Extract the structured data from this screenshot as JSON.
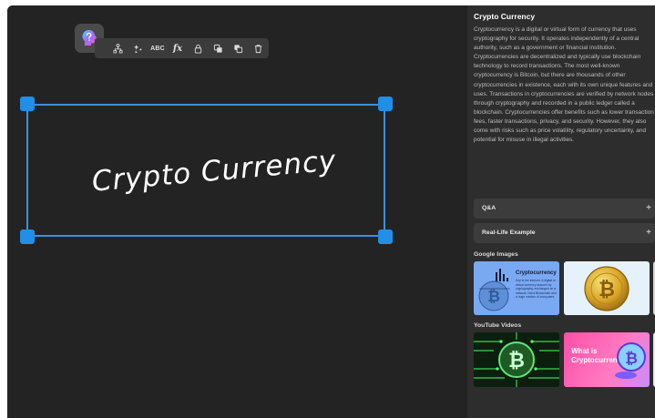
{
  "canvas": {
    "handwritten_text": "Crypto Currency",
    "toolbar": {
      "abc_label": "ABC",
      "fx_label": "fx"
    }
  },
  "panel": {
    "title": "Crypto Currency",
    "description": "Cryptocurrency is a digital or virtual form of currency that uses cryptography for security. It operates independently of a central authority, such as a government or financial institution. Cryptocurrencies are decentralized and typically use blockchain technology to record transactions. The most well-known cryptocurrency is Bitcoin, but there are thousands of other cryptocurrencies in existence, each with its own unique features and uses. Transactions in cryptocurrencies are verified by network nodes through cryptography and recorded in a public ledger called a blockchain. Cryptocurrencies offer benefits such as lower transaction fees, faster transactions, privacy, and security. However, they also come with risks such as price volatility, regulatory uncertainty, and potential for misuse in illegal activities.",
    "qa_label": "Q&A",
    "example_label": "Real-Life Example",
    "plus_symbol": "+",
    "google_images_label": "Google Images",
    "youtube_label": "YouTube Videos",
    "google_thumb_1": {
      "title": "Cryptocurrency",
      "text": "Key to the internet. A digital or virtual currency secured by cryptography, exchanged on a network. Not a Blockchain and a huge number of computers."
    },
    "youtube_thumb_2": {
      "title": "What is Cryptocurrency?"
    }
  },
  "colors": {
    "selection_blue": "#1f8fe8",
    "canvas_bg": "#232323",
    "panel_bg": "#2d2d2d"
  }
}
